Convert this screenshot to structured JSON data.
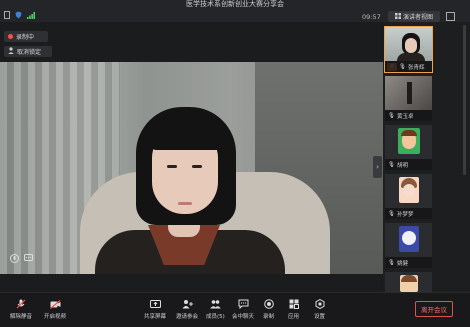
{
  "header": {
    "title": "医学技术系创新创业大赛分享会",
    "clock": "09:57",
    "view_button": "演讲者视图",
    "view_icon": "grid-icon",
    "fullscreen_icon": "fullscreen-icon"
  },
  "status_icons": [
    "sim-card-icon",
    "shield-icon",
    "signal-icon"
  ],
  "controls": {
    "recording": "录制中",
    "unlock": "取消锁定"
  },
  "main_video": {
    "mic_icon": "microphone-icon",
    "chat_icon": "chat-icon"
  },
  "participants": [
    {
      "name": "张青辉",
      "active": true,
      "host": true
    },
    {
      "name": "黄玉卓",
      "active": false,
      "host": false
    },
    {
      "name": "胡明",
      "active": false,
      "host": false
    },
    {
      "name": "孙梦梦",
      "active": false,
      "host": false
    },
    {
      "name": "姚健",
      "active": false,
      "host": false
    },
    {
      "name": "",
      "active": false,
      "host": false
    }
  ],
  "toolbar": {
    "mute": "解除静音",
    "video": "开启视频",
    "share": "共享屏幕",
    "invite": "邀请参会",
    "members": "成员(5)",
    "chat": "会中聊天",
    "record": "录制",
    "apps": "应用",
    "settings": "设置",
    "leave": "离开会议"
  },
  "colors": {
    "accent": "#f08a24",
    "danger": "#d9534f",
    "recording": "#ff4d4f"
  }
}
